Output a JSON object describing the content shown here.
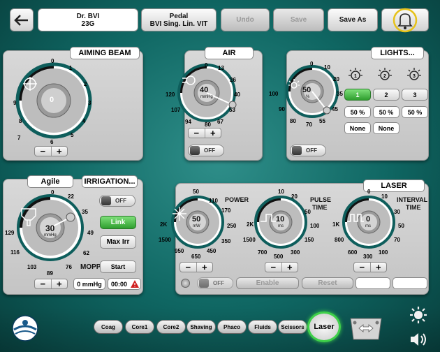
{
  "header": {
    "surgeon": {
      "line1": "Dr. BVI",
      "line2": "23G"
    },
    "pedal": {
      "line1": "Pedal",
      "line2": "BVI Sing. Lin. VIT"
    },
    "undo": "Undo",
    "save": "Save",
    "save_as": "Save As"
  },
  "aiming": {
    "title": "AIMING BEAM",
    "value": "0",
    "ticks": [
      "0",
      "1",
      "2",
      "3",
      "4",
      "5",
      "6",
      "7",
      "8",
      "9"
    ]
  },
  "air": {
    "title": "AIR",
    "value": "40",
    "unit": "mmHg",
    "ticks": [
      "0",
      "13",
      "26",
      "40",
      "53",
      "67",
      "80",
      "94",
      "107",
      "120"
    ],
    "toggle": "OFF"
  },
  "lights": {
    "title": "LIGHTS...",
    "value": "50",
    "unit": "%",
    "ticks": [
      "0",
      "10",
      "20",
      "35",
      "45",
      "55",
      "70",
      "80",
      "90",
      "100"
    ],
    "channels": [
      "1",
      "2",
      "3"
    ],
    "percents": [
      "50 %",
      "50 %",
      "50 %"
    ],
    "modes": [
      "None",
      "None"
    ],
    "toggle": "OFF"
  },
  "irrigation": {
    "mode": "Agile",
    "title": "IRRIGATION...",
    "value": "30",
    "unit": "mmHg",
    "ticks": [
      "0",
      "22",
      "35",
      "49",
      "62",
      "76",
      "89",
      "103",
      "116",
      "129"
    ],
    "off": "OFF",
    "link": "Link",
    "max_irr": "Max Irr",
    "mopp": "MOPP",
    "start": "Start",
    "pressure": "0 mmHg",
    "timer": "00:00"
  },
  "laser": {
    "title": "LASER",
    "power": {
      "label": "POWER",
      "value": "50",
      "unit": "mW",
      "ticks": [
        "50",
        "110",
        "170",
        "250",
        "350",
        "450",
        "650",
        "950",
        "1500",
        "2K"
      ]
    },
    "pulse": {
      "label": "PULSE",
      "label2": "TIME",
      "value": "10",
      "unit": "ms",
      "ticks": [
        "10",
        "20",
        "50",
        "100",
        "150",
        "300",
        "500",
        "700",
        "1500",
        "2K"
      ]
    },
    "interval": {
      "label": "INTERVAL",
      "label2": "TIME",
      "value": "0",
      "unit": "ms",
      "ticks": [
        "0",
        "10",
        "30",
        "50",
        "70",
        "100",
        "300",
        "600",
        "800",
        "1K"
      ]
    },
    "toggle": "OFF",
    "enable": "Enable",
    "reset": "Reset"
  },
  "bottom": {
    "modes": [
      "Coag",
      "Core1",
      "Core2",
      "Shaving",
      "Phaco",
      "Fluids",
      "Scissors"
    ],
    "active": "Laser"
  }
}
